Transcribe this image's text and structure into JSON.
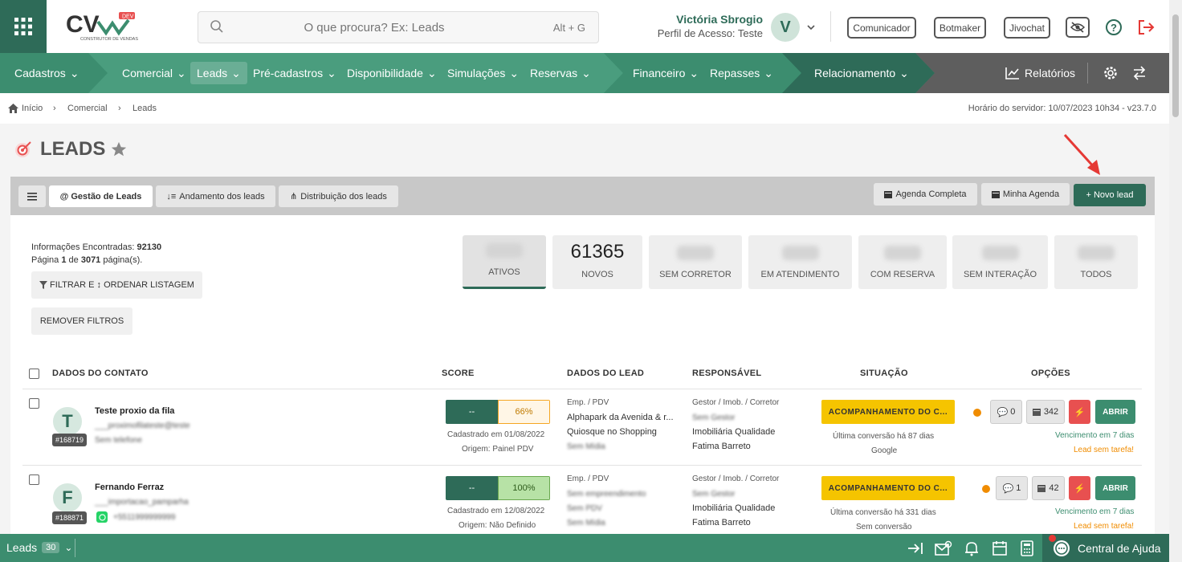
{
  "header": {
    "logo_text": "CV",
    "logo_badge": "DEV",
    "logo_sub": "CONSTRUTOR DE VENDAS",
    "search_placeholder": "O que procura? Ex: Leads",
    "search_shortcut": "Alt + G",
    "user_name": "Victória Sbrogio",
    "user_profile": "Perfil de Acesso: Teste",
    "user_initial": "V",
    "buttons": [
      "Comunicador",
      "Botmaker",
      "Jivochat"
    ]
  },
  "nav": {
    "items": [
      "Cadastros",
      "Comercial",
      "Leads",
      "Pré-cadastros",
      "Disponibilidade",
      "Simulações",
      "Reservas",
      "Financeiro",
      "Repasses",
      "Relacionamento"
    ],
    "reports": "Relatórios"
  },
  "breadcrumb": {
    "items": [
      "Início",
      "Comercial",
      "Leads"
    ],
    "server_time": "Horário do servidor: 10/07/2023 10h34 - v23.7.0"
  },
  "page": {
    "title": "LEADS"
  },
  "tabs": {
    "items": [
      "@ Gestão de Leads",
      "Andamento dos leads",
      "Distribuição dos leads"
    ],
    "agenda_completa": "Agenda Completa",
    "minha_agenda": "Minha Agenda",
    "novo_lead": "+ Novo lead"
  },
  "info": {
    "found_label": "Informações Encontradas:",
    "found_value": "92130",
    "page_label": "Página",
    "page_current": "1",
    "page_of": "de",
    "page_total": "3071",
    "page_suffix": "página(s).",
    "filter_btn": "FILTRAR E ↕ ORDENAR LISTAGEM",
    "remove_btn": "REMOVER FILTROS"
  },
  "stats": [
    {
      "label": "ATIVOS",
      "value": ""
    },
    {
      "label": "NOVOS",
      "value": "61365"
    },
    {
      "label": "SEM CORRETOR",
      "value": ""
    },
    {
      "label": "EM ATENDIMENTO",
      "value": ""
    },
    {
      "label": "COM RESERVA",
      "value": ""
    },
    {
      "label": "SEM INTERAÇÃO",
      "value": ""
    },
    {
      "label": "TODOS",
      "value": ""
    }
  ],
  "table": {
    "headers": [
      "DADOS DO CONTATO",
      "SCORE",
      "DADOS DO LEAD",
      "RESPONSÁVEL",
      "SITUAÇÃO",
      "OPÇÕES"
    ],
    "rows": [
      {
        "initial": "T",
        "id": "#168719",
        "name": "Teste proxio da fila",
        "email": "___proximofilateste@teste",
        "phone": "Sem telefone",
        "score_a": "--",
        "score_b": "66%",
        "registered": "Cadastrado em 01/08/2022",
        "origin": "Origem: Painel PDV",
        "lead_label": "Emp. / PDV",
        "lead_l1": "Alphapark da Avenida & r...",
        "lead_l2": "Quiosque no Shopping",
        "lead_l3": "Sem Mídia",
        "resp_label": "Gestor / Imob. / Corretor",
        "resp_l1": "Sem Gestor",
        "resp_l2": "Imobiliária Qualidade",
        "resp_l3": "Fatima Barreto",
        "situation": "ACOMPANHAMENTO DO C...",
        "conv": "Última conversão há 87 dias",
        "conv_src": "Google",
        "chat_count": "0",
        "cal_count": "342",
        "open": "ABRIR",
        "due": "Vencimento em 7 dias",
        "no_task": "Lead sem tarefa!"
      },
      {
        "initial": "F",
        "id": "#188871",
        "name": "Fernando Ferraz",
        "email": "___importacao_pamparha",
        "phone": "+5511999999999",
        "score_a": "--",
        "score_b": "100%",
        "registered": "Cadastrado em 12/08/2022",
        "origin": "Origem: Não Definido",
        "lead_label": "Emp. / PDV",
        "lead_l1": "Sem empreendimento",
        "lead_l2": "Sem PDV",
        "lead_l3": "Sem Mídia",
        "resp_label": "Gestor / Imob. / Corretor",
        "resp_l1": "Sem Gestor",
        "resp_l2": "Imobiliária Qualidade",
        "resp_l3": "Fatima Barreto",
        "situation": "ACOMPANHAMENTO DO C...",
        "conv": "Última conversão há 331 dias",
        "conv_src": "Sem conversão",
        "chat_count": "1",
        "cal_count": "42",
        "open": "ABRIR",
        "due": "Vencimento em 7 dias",
        "no_task": "Lead sem tarefa!"
      }
    ]
  },
  "bottom": {
    "label": "Leads",
    "count": "30",
    "help": "Central de Ajuda"
  },
  "colors": {
    "primary": "#2e6b58",
    "nav": "#3c8d6f",
    "yellow": "#f5c400",
    "danger": "#e85050",
    "orange": "#f08c00"
  }
}
